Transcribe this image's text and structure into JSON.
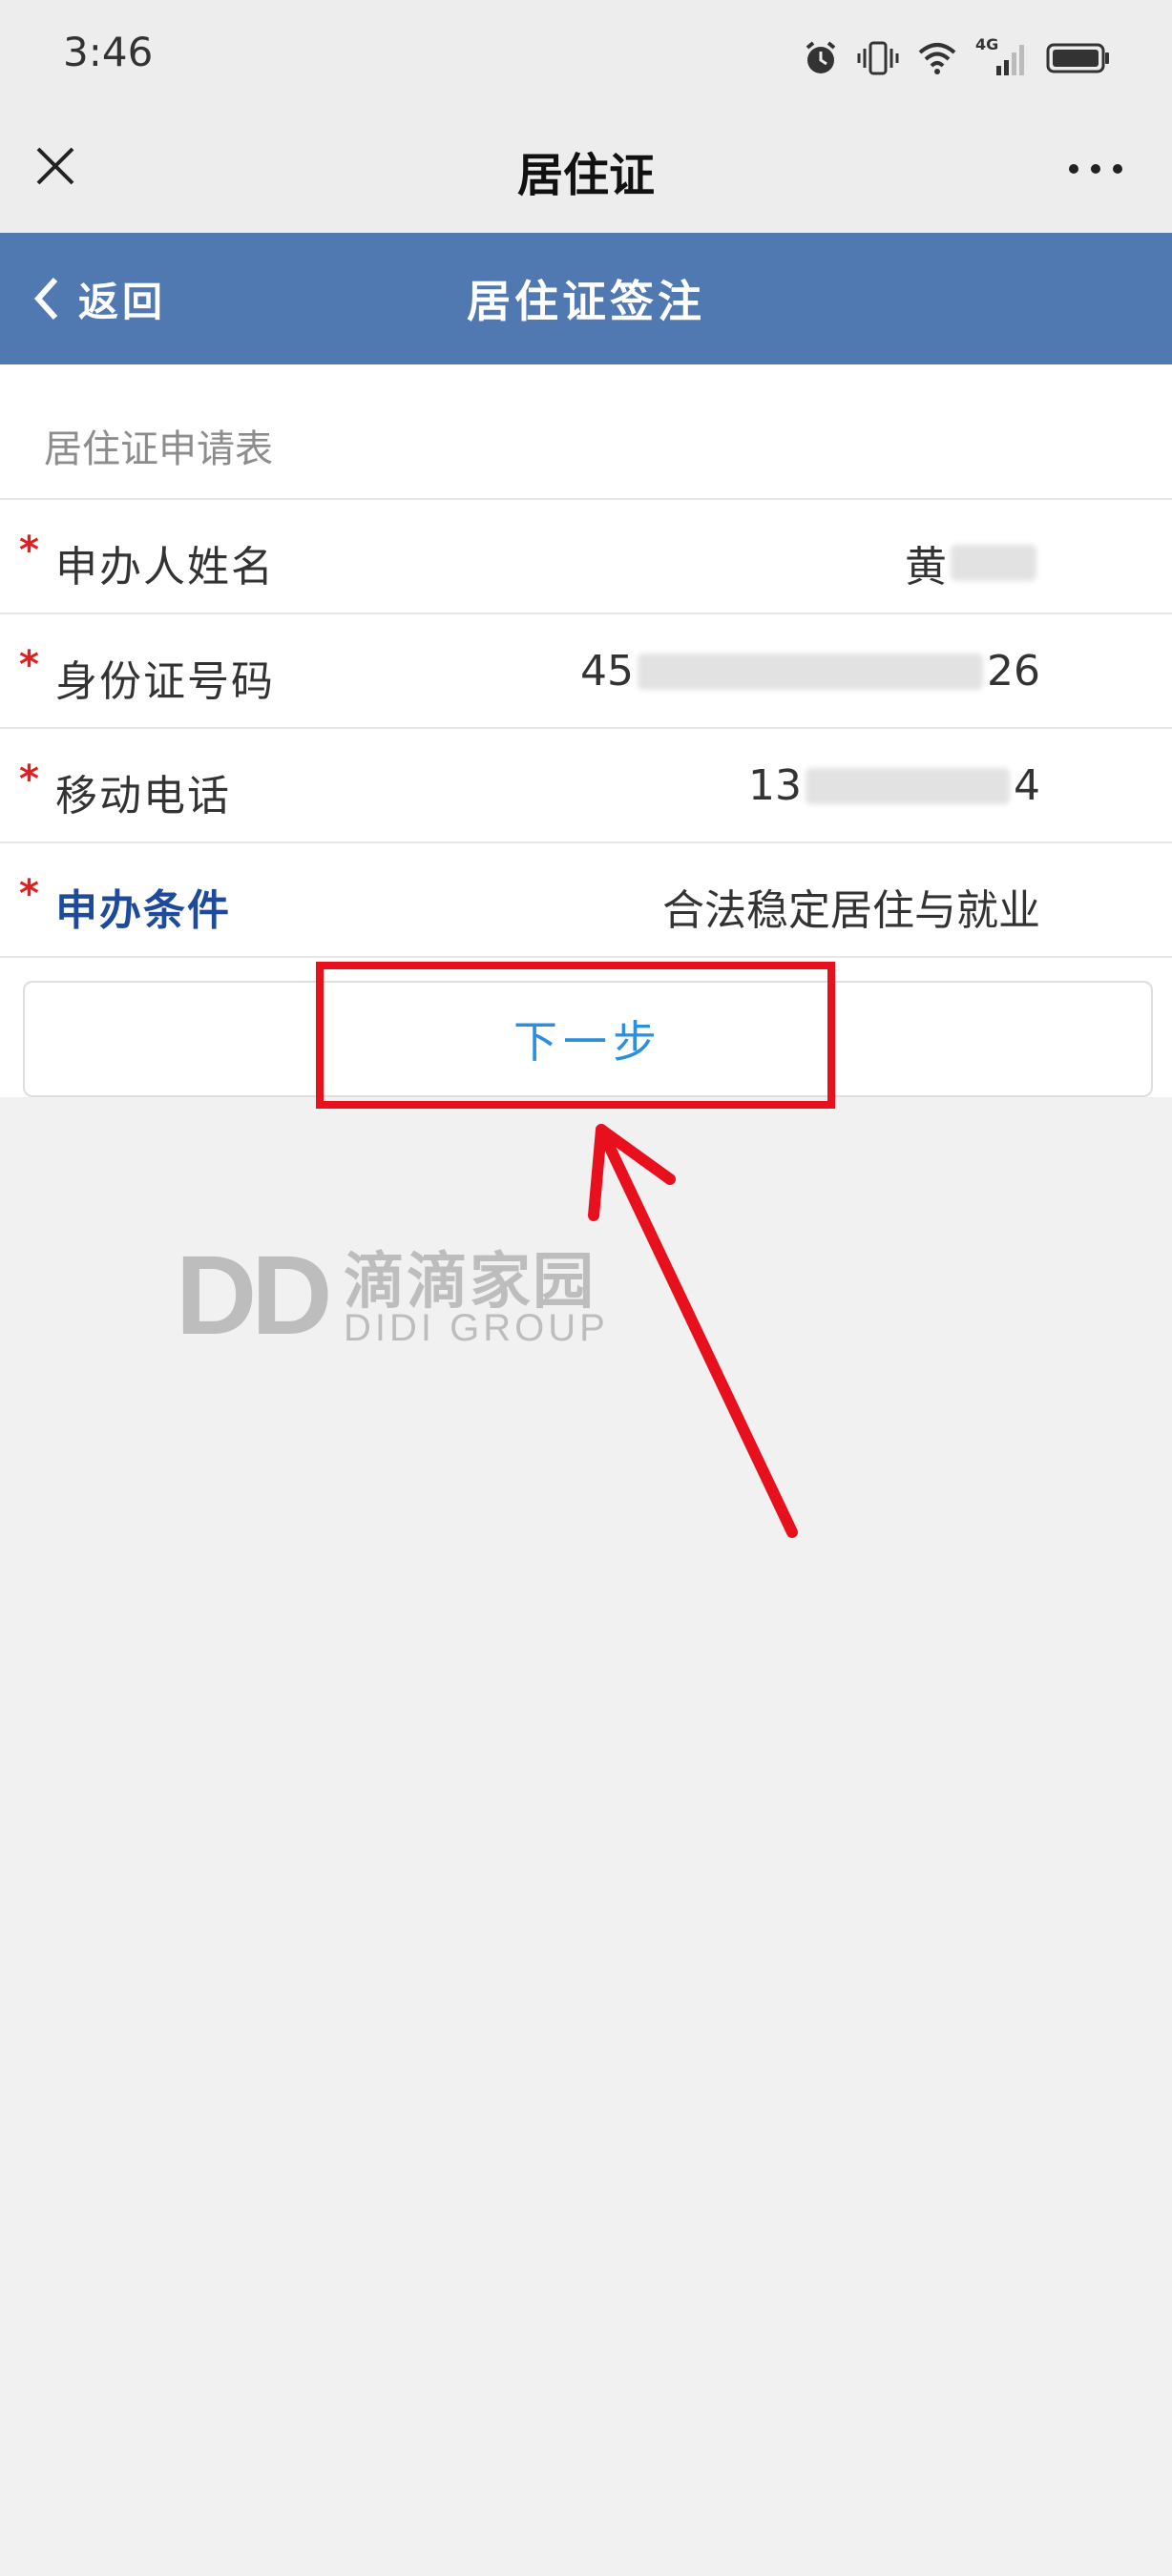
{
  "status_bar": {
    "time": "3:46",
    "network": "4G"
  },
  "wechat_header": {
    "title": "居住证"
  },
  "app_header": {
    "back_label": "返回",
    "title": "居住证签注",
    "background": "#5179b1"
  },
  "form": {
    "heading": "居住证申请表",
    "required_mark": "*",
    "fields": [
      {
        "label": "申办人姓名",
        "value_prefix": "黄",
        "value_suffix": ""
      },
      {
        "label": "身份证号码",
        "value_prefix": "45",
        "value_suffix": "26"
      },
      {
        "label": "移动电话",
        "value_prefix": "13",
        "value_suffix": "4"
      },
      {
        "label": "申办条件",
        "value_prefix": "合法稳定居住与就业",
        "value_suffix": ""
      }
    ]
  },
  "next_button": {
    "label": "下一步",
    "color": "#2b8fe0"
  },
  "annotation": {
    "color": "#e8101c"
  },
  "watermark": {
    "mark": "DD",
    "chinese": "滴滴家园",
    "english": "DIDI GROUP"
  }
}
